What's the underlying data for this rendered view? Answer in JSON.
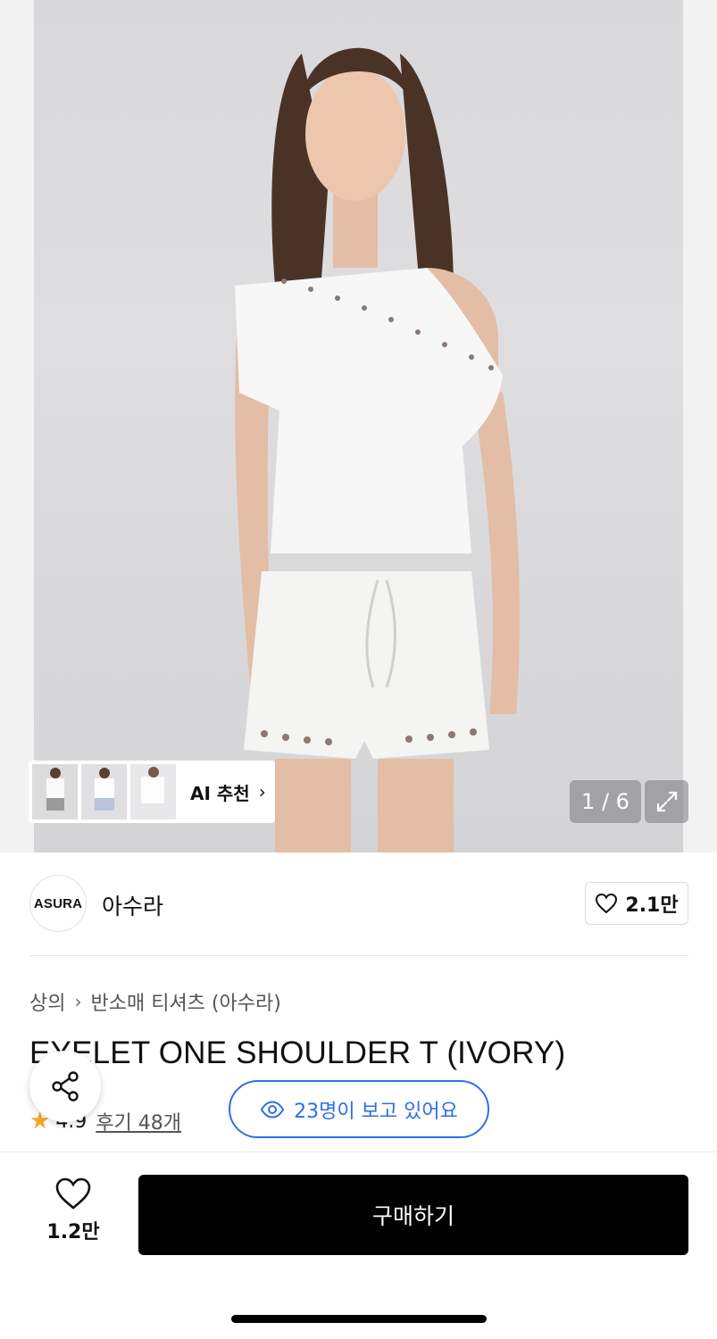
{
  "hero": {
    "pager": "1 / 6",
    "ai_recommend_label": "AI 추천",
    "thumbnails": [
      "thumbnail-1",
      "thumbnail-2",
      "thumbnail-3"
    ]
  },
  "brand": {
    "logo_text": "ASURA",
    "name": "아수라",
    "like_count": "2.1만"
  },
  "product": {
    "breadcrumb": [
      "상의",
      "반소매 티셔츠 (아수라)"
    ],
    "title": "EYELET ONE SHOULDER T (IVORY)",
    "rating": "4.9",
    "reviews": "후기 48개",
    "viewers": "23명이 보고 있어요"
  },
  "bottom_bar": {
    "wish_count": "1.2만",
    "buy_label": "구매하기"
  },
  "colors": {
    "accent_blue": "#2f6ee6",
    "star": "#f5a623",
    "buy_button": "#000000"
  },
  "icons": [
    "chevron-right-icon",
    "expand-icon",
    "heart-icon",
    "share-icon",
    "eye-icon",
    "star-icon"
  ]
}
